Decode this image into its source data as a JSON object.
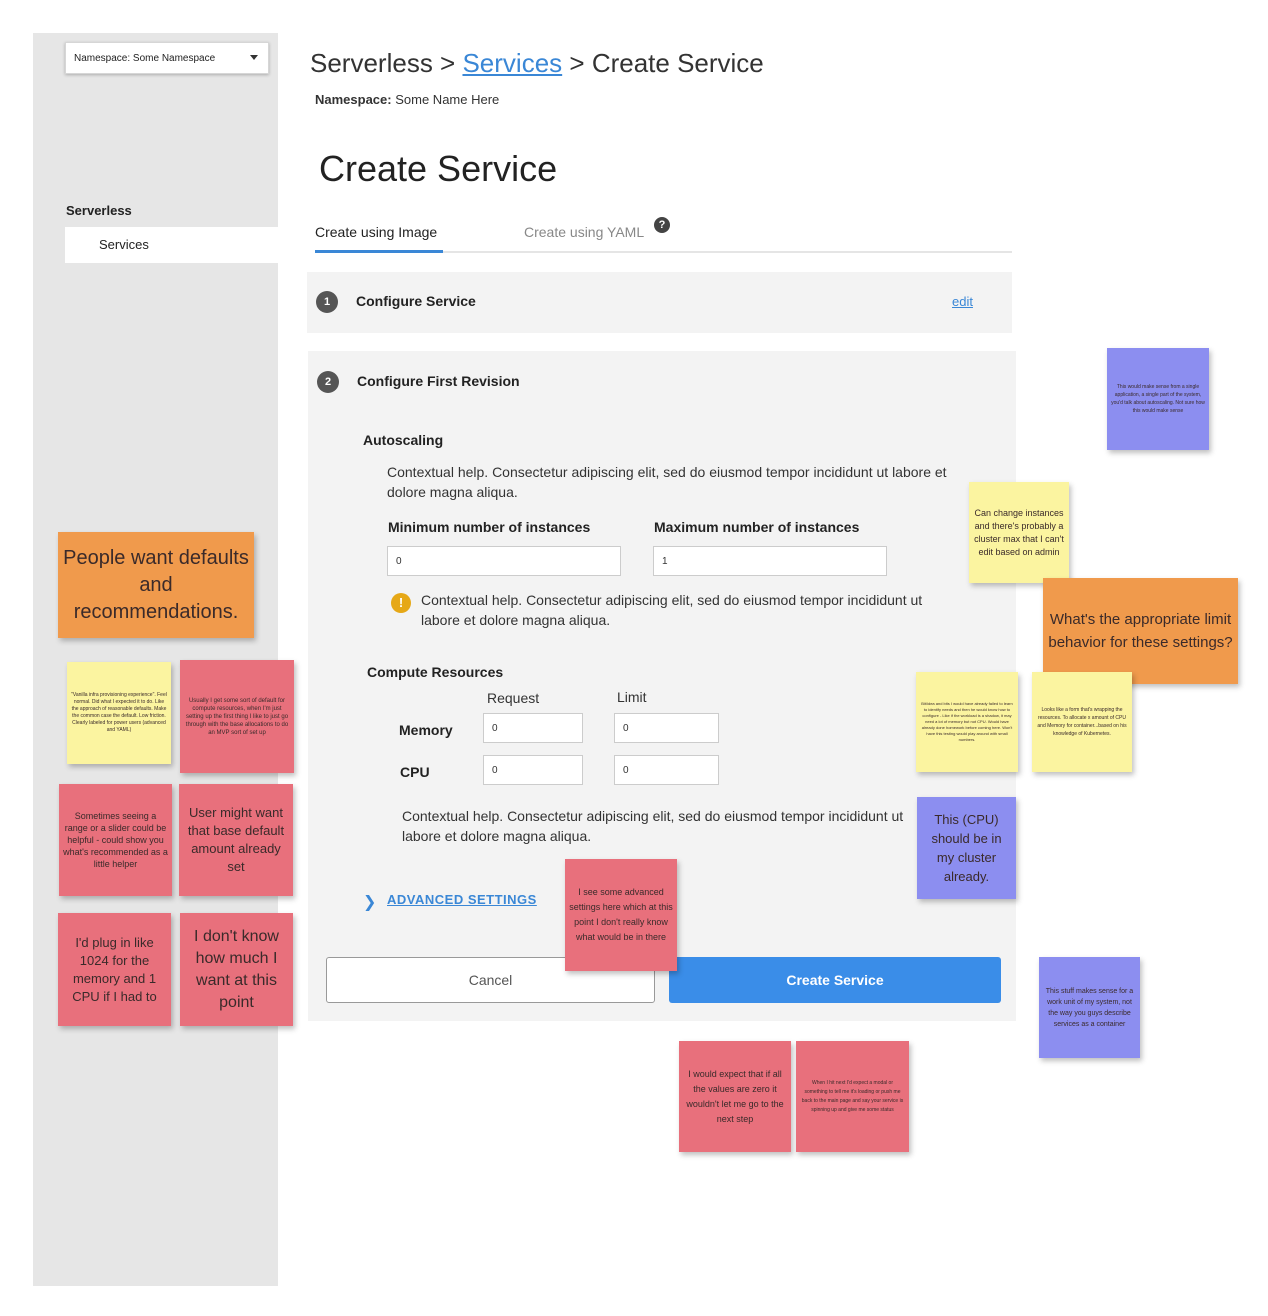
{
  "sidebar": {
    "namespace_select": "Namespace: Some Namespace",
    "heading": "Serverless",
    "items": [
      {
        "label": "Services"
      }
    ]
  },
  "header": {
    "breadcrumb_root": "Serverless >",
    "breadcrumb_link": "Services",
    "breadcrumb_current": "> Create Service",
    "namespace_label": "Namespace:",
    "namespace_value": "Some Name Here",
    "page_title": "Create Service"
  },
  "tabs": [
    {
      "label": "Create using Image",
      "active": true
    },
    {
      "label": "Create using YAML",
      "active": false
    }
  ],
  "step1": {
    "number": "1",
    "title": "Configure Service",
    "edit_label": "edit"
  },
  "step2": {
    "number": "2",
    "title": "Configure First Revision",
    "autoscaling": {
      "title": "Autoscaling",
      "help": "Contextual help. Consectetur adipiscing elit, sed do eiusmod tempor incididunt ut labore et dolore magna aliqua.",
      "min_label": "Minimum number of instances",
      "min_value": "0",
      "max_label": "Maximum number of instances",
      "max_value": "1",
      "warning": "Contextual help. Consectetur adipiscing elit, sed do eiusmod tempor incididunt ut labore et dolore magna aliqua."
    },
    "compute": {
      "title": "Compute Resources",
      "request_header": "Request",
      "limit_header": "Limit",
      "memory_label": "Memory",
      "memory_request": "0",
      "memory_limit": "0",
      "cpu_label": "CPU",
      "cpu_request": "0",
      "cpu_limit": "0",
      "help": "Contextual help. Consectetur adipiscing elit, sed do eiusmod tempor incididunt ut labore et dolore magna aliqua."
    },
    "advanced_label": "ADVANCED SETTINGS"
  },
  "buttons": {
    "cancel": "Cancel",
    "create": "Create Service"
  },
  "notes": {
    "people_want": "People want defaults and recommendations.",
    "vanilla": "\"Vanilla infra provisioning experience\". Feel normal. Did what I expected it to do. Like the approach of reasonable defaults. Make the common case the default. Low friction. Clearly labeled for power users (advanced and YAML)",
    "usually_get": "Usually I get some sort of default for compute resources, when I'm just setting up the first thing I like to just go through with the base allocations to do an MVP sort of set up",
    "range_slider": "Sometimes seeing a range or a slider could be helpful - could show you what's recommended as a little helper",
    "base_default": "User might want that base default amount already set",
    "plug_in": "I'd plug in like 1024 for the memory and 1 CPU if I had to",
    "dont_know": "I don't know how much I want at this point",
    "advanced_here": "I see some advanced settings here which at this point I don't really know what would be in there",
    "expect_zero": "I would expect that if all the values are zero it wouldn't let me go to the next step",
    "hit_next": "When I hit next I'd expect a modal or something to tell me it's loading or push me back to the main page and say your service is spinning up and give me some status",
    "single_app": "This would make sense from a single application, a single part of the system, you'd talk about autoscaling. Not sure how this would make sense",
    "can_change": "Can change instances and there's probably a cluster max that I can't edit based on admin",
    "limit_behavior": "What's the appropriate limit behavior for these settings?",
    "bit_idea": "Bit/idea and bits I would have already failed to learn to identify needs and then he would know how to configure - Like if the workload is a shadow, it may need a lot of memory but not CPU. Would have already done homework before coming here. Won't have this testing would play around with small numbers.",
    "looks_like": "Looks like a form that's wrapping the resources. To allocate x amount of CPU and Memory for container...based on his knowledge of Kubernetes.",
    "cpu_cluster": "This (CPU) should be in my cluster already.",
    "work_unit": "This stuff makes sense for a work unit of my system, not the way you guys describe services as a container"
  }
}
